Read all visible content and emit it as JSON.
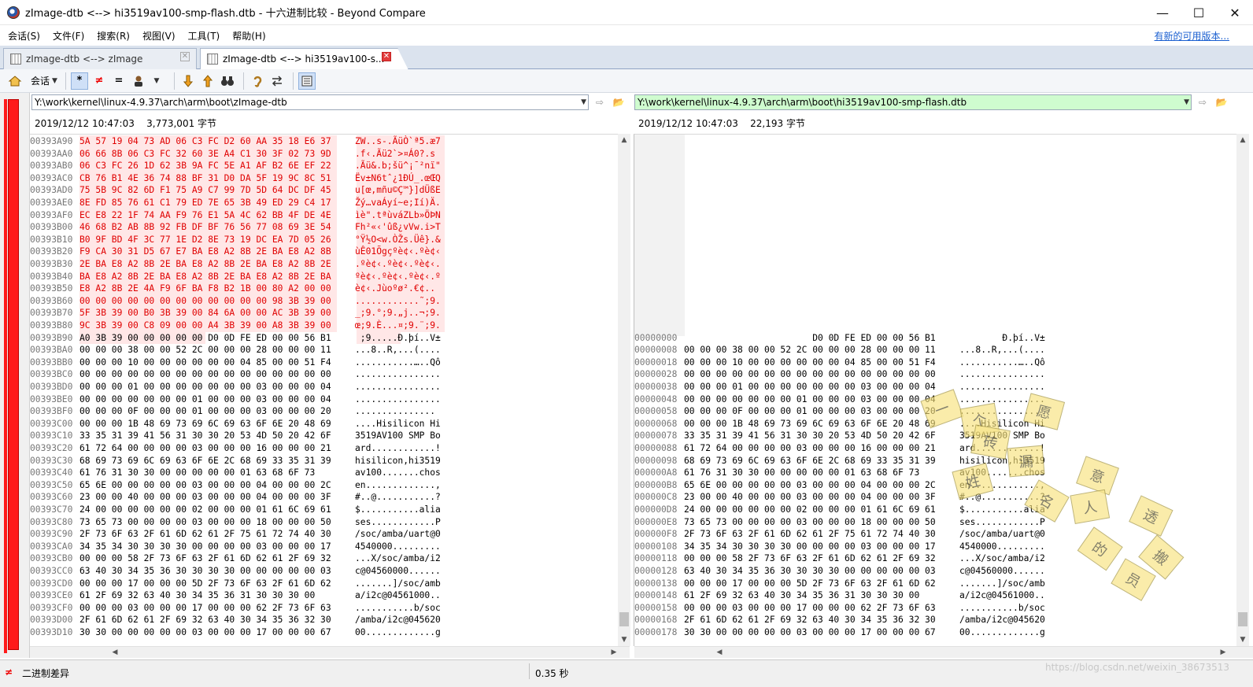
{
  "window": {
    "title": "zImage-dtb <--> hi3519av100-smp-flash.dtb - 十六进制比较 - Beyond Compare",
    "minimize": "—",
    "maximize": "☐",
    "close": "✕"
  },
  "menu": {
    "items": [
      "会话(S)",
      "文件(F)",
      "搜索(R)",
      "视图(V)",
      "工具(T)",
      "帮助(H)"
    ],
    "update_link": "有新的可用版本..."
  },
  "tabs": [
    {
      "label": "zImage-dtb <--> zImage",
      "close": "✕"
    },
    {
      "label": "zImage-dtb <--> hi3519av100-s...",
      "close": "✕"
    }
  ],
  "toolbar": {
    "session_label": "会话",
    "icons": [
      "home-icon",
      "all-icon",
      "diffs-icon",
      "same-icon",
      "person-icon",
      "next-diff-icon",
      "prev-diff-icon",
      "binoculars-icon",
      "ear-icon",
      "swap-icon",
      "list-icon"
    ]
  },
  "left": {
    "path": "Y:\\work\\kernel\\linux-4.9.37\\arch\\arm\\boot\\zImage-dtb",
    "date": "2019/12/12 10:47:03",
    "size": "3,773,001 字节",
    "rows": [
      {
        "addr": "00393A90",
        "hex": "5A 57 19 04 73 AD 06 C3 FC D2 60 AA 35 18 E6 37",
        "asc": "ZW..s-.ÃüÒ`ª5.æ7",
        "diff": true
      },
      {
        "addr": "00393AA0",
        "hex": "06 66 8B 06 C3 FC 32 60 3E A4 C1 30 3F 02 73 9D",
        "asc": ".f‹.Ãü2`>¤Á0?.s",
        "diff": true
      },
      {
        "addr": "00393AB0",
        "hex": "06 C3 FC 26 1D 62 3B 9A FC 5E A1 AF B2 6E EF 22",
        "asc": ".Ãü&.b;šü^¡¯²nï\"",
        "diff": true
      },
      {
        "addr": "00393AC0",
        "hex": "CB 76 B1 4E 36 74 88 BF 31 D0 DA 5F 19 9C 8C 51",
        "asc": "Ëv±N6tˆ¿1ÐÚ_.œŒQ",
        "diff": true
      },
      {
        "addr": "00393AD0",
        "hex": "75 5B 9C 82 6D F1 75 A9 C7 99 7D 5D 64 DC DF 45",
        "asc": "u[œ‚mñu©Ç™}]dÜßE",
        "diff": true
      },
      {
        "addr": "00393AE0",
        "hex": "8E FD 85 76 61 C1 79 ED 7E 65 3B 49 ED 29 C4 17",
        "asc": "Žý…vaÁyí~e;Ií)Ä.",
        "diff": true
      },
      {
        "addr": "00393AF0",
        "hex": "EC E8 22 1F 74 AA F9 76 E1 5A 4C 62 BB 4F DE 4E",
        "asc": "ìè\".tªùváZLb»ÖÞN",
        "diff": true
      },
      {
        "addr": "00393B00",
        "hex": "46 68 B2 AB 8B 92 FB DF BF 76 56 77 08 69 3E 54",
        "asc": "Fh²«‹'ûß¿vVw.i>T",
        "diff": true
      },
      {
        "addr": "00393B10",
        "hex": "B0 9F BD 4F 3C 77 1E D2 8E 73 19 DC EA 7D 05 26",
        "asc": "°Ÿ½O<w.ÒŽs.Üê}.&",
        "diff": true
      },
      {
        "addr": "00393B20",
        "hex": "F9 CA 30 31 D5 67 E7 BA E8 A2 8B 2E BA E8 A2 8B",
        "asc": "ùÊ01Õgçºè¢‹.ºè¢‹",
        "diff": true
      },
      {
        "addr": "00393B30",
        "hex": "2E BA E8 A2 8B 2E BA E8 A2 8B 2E BA E8 A2 8B 2E",
        "asc": ".ºè¢‹.ºè¢‹.ºè¢‹.",
        "diff": true
      },
      {
        "addr": "00393B40",
        "hex": "BA E8 A2 8B 2E BA E8 A2 8B 2E BA E8 A2 8B 2E BA",
        "asc": "ºè¢‹.ºè¢‹.ºè¢‹.º",
        "diff": true
      },
      {
        "addr": "00393B50",
        "hex": "E8 A2 8B 2E 4A F9 6F BA F8 B2 1B 00 80 A2 00 00",
        "asc": "è¢‹.Jùoºø².€¢..",
        "diff": true
      },
      {
        "addr": "00393B60",
        "hex": "00 00 00 00 00 00 00 00 00 00 00 00 98 3B 39 00",
        "asc": "............˜;9.",
        "diff": true
      },
      {
        "addr": "00393B70",
        "hex": "5F 3B 39 00 B0 3B 39 00 84 6A 00 00 AC 3B 39 00",
        "asc": "_;9.°;9.„j..¬;9.",
        "diff": true
      },
      {
        "addr": "00393B80",
        "hex": "9C 3B 39 00 C8 09 00 00 A4 3B 39 00 A8 3B 39 00",
        "asc": "œ;9.È...¤;9.¨;9.",
        "diff": true
      },
      {
        "addr": "00393B90",
        "hex": "A0 3B 39 00 00 00 00 00 D0 0D FE ED 00 00 56 B1",
        "asc": " ;9.....Ð.þí..V±",
        "diff": "partial"
      },
      {
        "addr": "00393BA0",
        "hex": "00 00 00 38 00 00 52 2C 00 00 00 28 00 00 00 11",
        "asc": "...8..R,...(....",
        "diff": false
      },
      {
        "addr": "00393BB0",
        "hex": "00 00 00 10 00 00 00 00 00 00 04 85 00 00 51 F4",
        "asc": "...........…..Qô",
        "diff": false
      },
      {
        "addr": "00393BC0",
        "hex": "00 00 00 00 00 00 00 00 00 00 00 00 00 00 00 00",
        "asc": "................",
        "diff": false
      },
      {
        "addr": "00393BD0",
        "hex": "00 00 00 01 00 00 00 00 00 00 00 03 00 00 00 04",
        "asc": "................",
        "diff": false
      },
      {
        "addr": "00393BE0",
        "hex": "00 00 00 00 00 00 00 01 00 00 00 03 00 00 00 04",
        "asc": "................",
        "diff": false
      },
      {
        "addr": "00393BF0",
        "hex": "00 00 00 0F 00 00 00 01 00 00 00 03 00 00 00 20",
        "asc": "............... ",
        "diff": false
      },
      {
        "addr": "00393C00",
        "hex": "00 00 00 1B 48 69 73 69 6C 69 63 6F 6E 20 48 69",
        "asc": "....Hisilicon Hi",
        "diff": false
      },
      {
        "addr": "00393C10",
        "hex": "33 35 31 39 41 56 31 30 30 20 53 4D 50 20 42 6F",
        "asc": "3519AV100 SMP Bo",
        "diff": false
      },
      {
        "addr": "00393C20",
        "hex": "61 72 64 00 00 00 00 03 00 00 00 16 00 00 00 21",
        "asc": "ard............!",
        "diff": false
      },
      {
        "addr": "00393C30",
        "hex": "68 69 73 69 6C 69 63 6F 6E 2C 68 69 33 35 31 39",
        "asc": "hisilicon,hi3519",
        "diff": false
      },
      {
        "addr": "00393C40",
        "hex": "61 76 31 30 30 00 00 00 00 00 01 63 68 6F 73",
        "asc": "av100.......chos",
        "diff": false
      },
      {
        "addr": "00393C50",
        "hex": "65 6E 00 00 00 00 00 03 00 00 00 04 00 00 00 2C",
        "asc": "en.............,",
        "diff": false
      },
      {
        "addr": "00393C60",
        "hex": "23 00 00 40 00 00 00 03 00 00 00 04 00 00 00 3F",
        "asc": "#..@...........?",
        "diff": false
      },
      {
        "addr": "00393C70",
        "hex": "24 00 00 00 00 00 00 02 00 00 00 01 61 6C 69 61",
        "asc": "$...........alia",
        "diff": false
      },
      {
        "addr": "00393C80",
        "hex": "73 65 73 00 00 00 00 03 00 00 00 18 00 00 00 50",
        "asc": "ses............P",
        "diff": false
      },
      {
        "addr": "00393C90",
        "hex": "2F 73 6F 63 2F 61 6D 62 61 2F 75 61 72 74 40 30",
        "asc": "/soc/amba/uart@0",
        "diff": false
      },
      {
        "addr": "00393CA0",
        "hex": "34 35 34 30 30 30 30 00 00 00 00 03 00 00 00 17",
        "asc": "4540000.........",
        "diff": false
      },
      {
        "addr": "00393CB0",
        "hex": "00 00 00 58 2F 73 6F 63 2F 61 6D 62 61 2F 69 32",
        "asc": "...X/soc/amba/i2",
        "diff": false
      },
      {
        "addr": "00393CC0",
        "hex": "63 40 30 34 35 36 30 30 30 30 00 00 00 00 00 03",
        "asc": "c@04560000......",
        "diff": false
      },
      {
        "addr": "00393CD0",
        "hex": "00 00 00 17 00 00 00 5D 2F 73 6F 63 2F 61 6D 62",
        "asc": ".......]/soc/amb",
        "diff": false
      },
      {
        "addr": "00393CE0",
        "hex": "61 2F 69 32 63 40 30 34 35 36 31 30 30 30 00",
        "asc": "a/i2c@04561000..",
        "diff": false
      },
      {
        "addr": "00393CF0",
        "hex": "00 00 00 03 00 00 00 17 00 00 00 62 2F 73 6F 63",
        "asc": "...........b/soc",
        "diff": false
      },
      {
        "addr": "00393D00",
        "hex": "2F 61 6D 62 61 2F 69 32 63 40 30 34 35 36 32 30",
        "asc": "/amba/i2c@045620",
        "diff": false
      },
      {
        "addr": "00393D10",
        "hex": "30 30 00 00 00 00 00 03 00 00 00 17 00 00 00 67",
        "asc": "00.............g",
        "diff": false
      }
    ]
  },
  "right": {
    "path": "Y:\\work\\kernel\\linux-4.9.37\\arch\\arm\\boot\\hi3519av100-smp-flash.dtb",
    "date": "2019/12/12 10:47:03",
    "size": "22,193 字节",
    "rows": [
      {
        "addr": "00000000",
        "hex": "                        D0 0D FE ED 00 00 56 B1",
        "asc": "        Ð.þí..V±"
      },
      {
        "addr": "00000008",
        "hex": "00 00 00 38 00 00 52 2C 00 00 00 28 00 00 00 11",
        "asc": "...8..R,...(...."
      },
      {
        "addr": "00000018",
        "hex": "00 00 00 10 00 00 00 00 00 00 04 85 00 00 51 F4",
        "asc": "...........…..Qô"
      },
      {
        "addr": "00000028",
        "hex": "00 00 00 00 00 00 00 00 00 00 00 00 00 00 00 00",
        "asc": "................"
      },
      {
        "addr": "00000038",
        "hex": "00 00 00 01 00 00 00 00 00 00 00 03 00 00 00 04",
        "asc": "................"
      },
      {
        "addr": "00000048",
        "hex": "00 00 00 00 00 00 00 01 00 00 00 03 00 00 00 04",
        "asc": "................"
      },
      {
        "addr": "00000058",
        "hex": "00 00 00 0F 00 00 00 01 00 00 00 03 00 00 00 20",
        "asc": "............... "
      },
      {
        "addr": "00000068",
        "hex": "00 00 00 1B 48 69 73 69 6C 69 63 6F 6E 20 48 69",
        "asc": "....Hisilicon Hi"
      },
      {
        "addr": "00000078",
        "hex": "33 35 31 39 41 56 31 30 30 20 53 4D 50 20 42 6F",
        "asc": "3519AV100 SMP Bo"
      },
      {
        "addr": "00000088",
        "hex": "61 72 64 00 00 00 00 03 00 00 00 16 00 00 00 21",
        "asc": "ard............!"
      },
      {
        "addr": "00000098",
        "hex": "68 69 73 69 6C 69 63 6F 6E 2C 68 69 33 35 31 39",
        "asc": "hisilicon,hi3519"
      },
      {
        "addr": "000000A8",
        "hex": "61 76 31 30 30 00 00 00 00 00 01 63 68 6F 73",
        "asc": "av100.......chos"
      },
      {
        "addr": "000000B8",
        "hex": "65 6E 00 00 00 00 00 03 00 00 00 04 00 00 00 2C",
        "asc": "en.............,"
      },
      {
        "addr": "000000C8",
        "hex": "23 00 00 40 00 00 00 03 00 00 00 04 00 00 00 3F",
        "asc": "#..@...........?"
      },
      {
        "addr": "000000D8",
        "hex": "24 00 00 00 00 00 00 02 00 00 00 01 61 6C 69 61",
        "asc": "$...........alia"
      },
      {
        "addr": "000000E8",
        "hex": "73 65 73 00 00 00 00 03 00 00 00 18 00 00 00 50",
        "asc": "ses............P"
      },
      {
        "addr": "000000F8",
        "hex": "2F 73 6F 63 2F 61 6D 62 61 2F 75 61 72 74 40 30",
        "asc": "/soc/amba/uart@0"
      },
      {
        "addr": "00000108",
        "hex": "34 35 34 30 30 30 30 00 00 00 00 03 00 00 00 17",
        "asc": "4540000........."
      },
      {
        "addr": "00000118",
        "hex": "00 00 00 58 2F 73 6F 63 2F 61 6D 62 61 2F 69 32",
        "asc": "...X/soc/amba/i2"
      },
      {
        "addr": "00000128",
        "hex": "63 40 30 34 35 36 30 30 30 30 00 00 00 00 00 03",
        "asc": "c@04560000......"
      },
      {
        "addr": "00000138",
        "hex": "00 00 00 17 00 00 00 5D 2F 73 6F 63 2F 61 6D 62",
        "asc": ".......]/soc/amb"
      },
      {
        "addr": "00000148",
        "hex": "61 2F 69 32 63 40 30 34 35 36 31 30 30 30 00",
        "asc": "a/i2c@04561000.."
      },
      {
        "addr": "00000158",
        "hex": "00 00 00 03 00 00 00 17 00 00 00 62 2F 73 6F 63",
        "asc": "...........b/soc"
      },
      {
        "addr": "00000168",
        "hex": "2F 61 6D 62 61 2F 69 32 63 40 30 34 35 36 32 30",
        "asc": "/amba/i2c@045620"
      },
      {
        "addr": "00000178",
        "hex": "30 30 00 00 00 00 00 03 00 00 00 17 00 00 00 67",
        "asc": "00.............g"
      }
    ]
  },
  "status": {
    "text": "二进制差异",
    "time": "0.35 秒",
    "watermark": "https://blog.csdn.net/weixin_38673513"
  },
  "watermark_chars": [
    "一",
    "个",
    "愿",
    "意",
    "透",
    "漏",
    "姓",
    "名",
    "的",
    "搬",
    "砖",
    "人",
    "员"
  ],
  "colors": {
    "diff_text": "#e00000",
    "diff_bg": "#ffe7e7",
    "gutter_bar": "#ff1a1a",
    "right_path_bg": "#cffccf",
    "link": "#1a5fd0"
  }
}
